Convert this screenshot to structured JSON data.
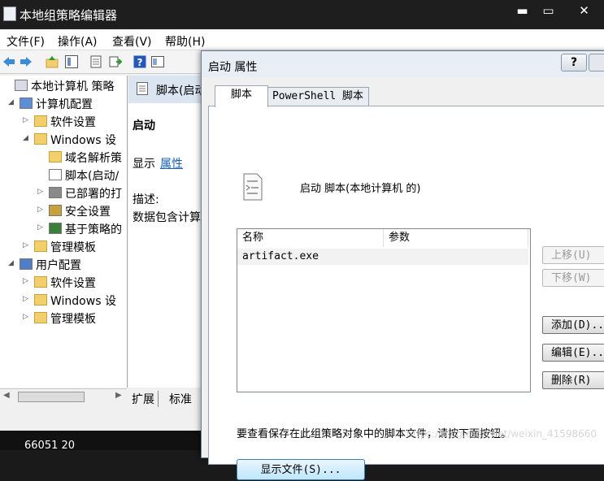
{
  "window": {
    "title": "本地组策略编辑器",
    "controls": [
      "▬",
      "▭",
      "✕"
    ]
  },
  "menu": [
    "文件(F)",
    "操作(A)",
    "查看(V)",
    "帮助(H)"
  ],
  "tree": [
    {
      "label": "本地计算机 策略",
      "indent": 0,
      "expander": "",
      "icon": "policy-icon"
    },
    {
      "label": "计算机配置",
      "indent": 1,
      "expander": "◢",
      "icon": "computer-icon"
    },
    {
      "label": "软件设置",
      "indent": 2,
      "expander": "▷",
      "icon": "folder-icon"
    },
    {
      "label": "Windows 设",
      "indent": 2,
      "expander": "◢",
      "icon": "folder-icon"
    },
    {
      "label": "域名解析策",
      "indent": 3,
      "expander": "",
      "icon": "folder-icon"
    },
    {
      "label": "脚本(启动/",
      "indent": 3,
      "expander": "",
      "icon": "script-icon"
    },
    {
      "label": "已部署的打",
      "indent": 3,
      "expander": "▷",
      "icon": "printer-icon"
    },
    {
      "label": "安全设置",
      "indent": 3,
      "expander": "▷",
      "icon": "security-icon"
    },
    {
      "label": "基于策略的",
      "indent": 3,
      "expander": "▷",
      "icon": "chart-icon"
    },
    {
      "label": "管理模板",
      "indent": 2,
      "expander": "▷",
      "icon": "folder-icon"
    },
    {
      "label": "用户配置",
      "indent": 1,
      "expander": "◢",
      "icon": "user-icon"
    },
    {
      "label": "软件设置",
      "indent": 2,
      "expander": "▷",
      "icon": "folder-icon"
    },
    {
      "label": "Windows 设",
      "indent": 2,
      "expander": "▷",
      "icon": "folder-icon"
    },
    {
      "label": "管理模板",
      "indent": 2,
      "expander": "▷",
      "icon": "folder-icon"
    }
  ],
  "middle": {
    "header": "脚本(启动",
    "section": "启动",
    "show_label": "显示",
    "properties_link": "属性",
    "desc_label": "描述:",
    "desc_text": "数据包含计算",
    "tabs": [
      "扩展",
      "标准"
    ]
  },
  "dialog": {
    "title": "启动 属性",
    "help": "?",
    "tabs": [
      "脚本",
      "PowerShell 脚本"
    ],
    "heading": "启动 脚本(本地计算机 的)",
    "columns": [
      "名称",
      "参数"
    ],
    "rows": [
      {
        "name": "artifact.exe",
        "params": ""
      }
    ],
    "buttons": {
      "up": "上移(U)",
      "down": "下移(W)",
      "add": "添加(D)...",
      "edit": "编辑(E)...",
      "remove": "删除(R)"
    },
    "hint": "要查看保存在此组策略对象中的脚本文件，请按下面按钮。",
    "show_files": "显示文件(S)..."
  },
  "watermark": "https://blog.csdn.net/weixin_41598660",
  "bottom_number": "66051 20"
}
